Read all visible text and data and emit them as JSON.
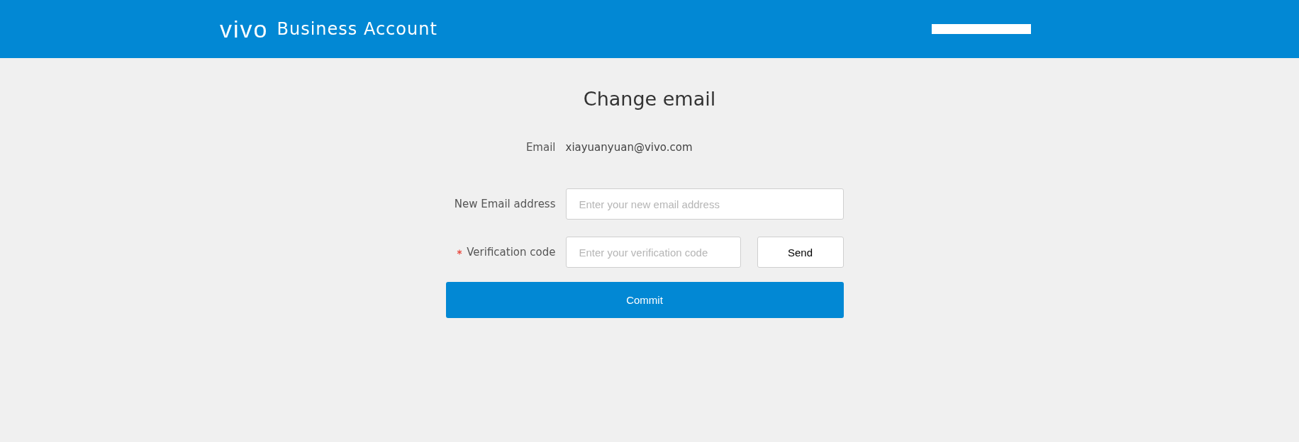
{
  "header": {
    "logo": "vivo",
    "title": "Business Account"
  },
  "page_title": "Change email",
  "current_email": {
    "label": "Email",
    "value": "xiayuanyuan@vivo.com"
  },
  "fields": [
    {
      "label": "New Email address",
      "placeholder": "Enter your new email address",
      "required": false
    },
    {
      "label": "Verification code",
      "placeholder": "Enter your verification code",
      "required": true,
      "button": "Send"
    }
  ],
  "submit": "Commit"
}
